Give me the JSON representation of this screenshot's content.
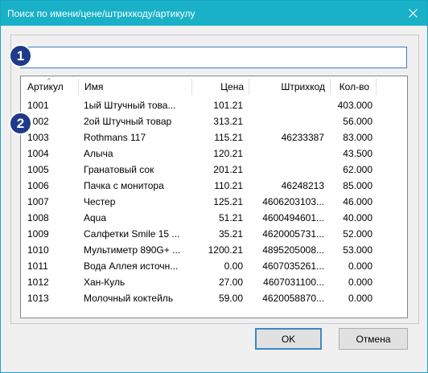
{
  "window": {
    "title": "Поиск по имени/цене/штрихкоду/артикулу"
  },
  "search": {
    "value": ""
  },
  "badges": [
    "1",
    "2"
  ],
  "table": {
    "columns": [
      "Артикул",
      "Имя",
      "Цена",
      "Штрихкод",
      "Кол-во"
    ],
    "sorted_column": "Артикул",
    "rows": [
      [
        "1001",
        "1ый Штучный това...",
        "101.21",
        "",
        "403.000"
      ],
      [
        "1002",
        "2ой Штучный товар",
        "313.21",
        "",
        "56.000"
      ],
      [
        "1003",
        "Rothmans 117",
        "115.21",
        "46233387",
        "83.000"
      ],
      [
        "1004",
        "Алыча",
        "120.21",
        "",
        "43.500"
      ],
      [
        "1005",
        "Гранатовый сок",
        "201.21",
        "",
        "62.000"
      ],
      [
        "1006",
        "Пачка с монитора",
        "110.21",
        "46248213",
        "85.000"
      ],
      [
        "1007",
        "Честер",
        "125.21",
        "4606203103...",
        "46.000"
      ],
      [
        "1008",
        "Aqua",
        "51.21",
        "4600494601...",
        "40.000"
      ],
      [
        "1009",
        "Салфетки Smile 15 ...",
        "35.21",
        "4620005731...",
        "52.000"
      ],
      [
        "1010",
        "Мультиметр 890G+ ...",
        "1200.21",
        "4895205008...",
        "53.000"
      ],
      [
        "1011",
        "Вода Аллея источн...",
        "0.00",
        "4607035261...",
        "0.000"
      ],
      [
        "1012",
        "Хан-Куль",
        "27.00",
        "4607031100...",
        "0.000"
      ],
      [
        "1013",
        "Молочный коктейль",
        "59.00",
        "4620058870...",
        "0.000"
      ]
    ]
  },
  "buttons": {
    "ok": "OK",
    "cancel": "Отмена"
  },
  "colors": {
    "titlebar": "#19b1c8",
    "badge": "#1f3a8a",
    "focus": "#3b7fbf"
  }
}
